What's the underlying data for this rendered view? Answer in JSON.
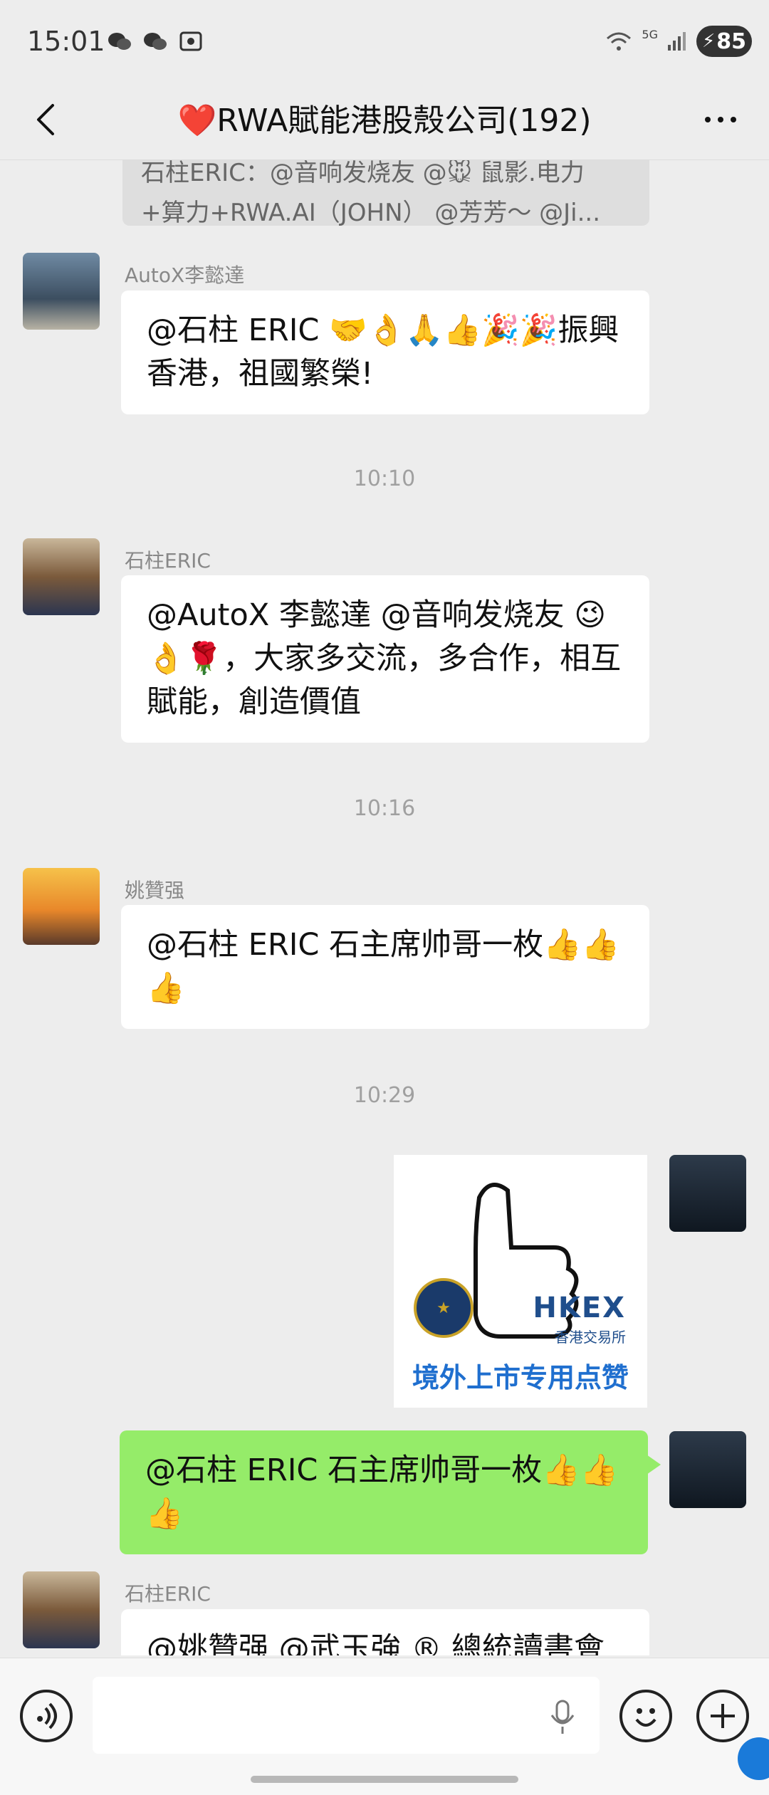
{
  "status_bar": {
    "time": "15:01",
    "network": "5G",
    "battery": "85"
  },
  "header": {
    "title": "RWA賦能港股殼公司(192)",
    "title_prefix": "❤️"
  },
  "chat": {
    "quoted": {
      "line1": "石柱ERIC：@音响发烧友 @🐭 鼠影.电力",
      "line2": "+算力+RWA.AI（JOHN） @芳芳～ @Ji..."
    },
    "messages": [
      {
        "sender": "AutoX李懿達",
        "text": "@石柱 ERIC 🤝👌🙏👍🎉🎉振興香港，祖國繁榮!"
      },
      {
        "type": "time",
        "text": "10:10"
      },
      {
        "sender": "石柱ERIC",
        "text": "@AutoX 李懿達 @音响发烧友 😉👌🌹，大家多交流，多合作，相互賦能，創造價值"
      },
      {
        "type": "time",
        "text": "10:16"
      },
      {
        "sender": "姚贊强",
        "text": "@石柱 ERIC 石主席帅哥一枚👍👍👍"
      },
      {
        "type": "time",
        "text": "10:29"
      },
      {
        "type": "sticker",
        "brand": "HKEX",
        "brand_cn": "香港交易所",
        "caption": "境外上市专用点赞"
      },
      {
        "mine": true,
        "text": "@石柱 ERIC 石主席帅哥一枚👍👍👍"
      },
      {
        "sender": "石柱ERIC",
        "text": "@姚贊强 @武玉強 ® 總統讀書會創"
      }
    ]
  },
  "icons": [
    "back-icon",
    "more-icon",
    "voice-icon",
    "mic-icon",
    "emoji-icon",
    "plus-icon"
  ]
}
